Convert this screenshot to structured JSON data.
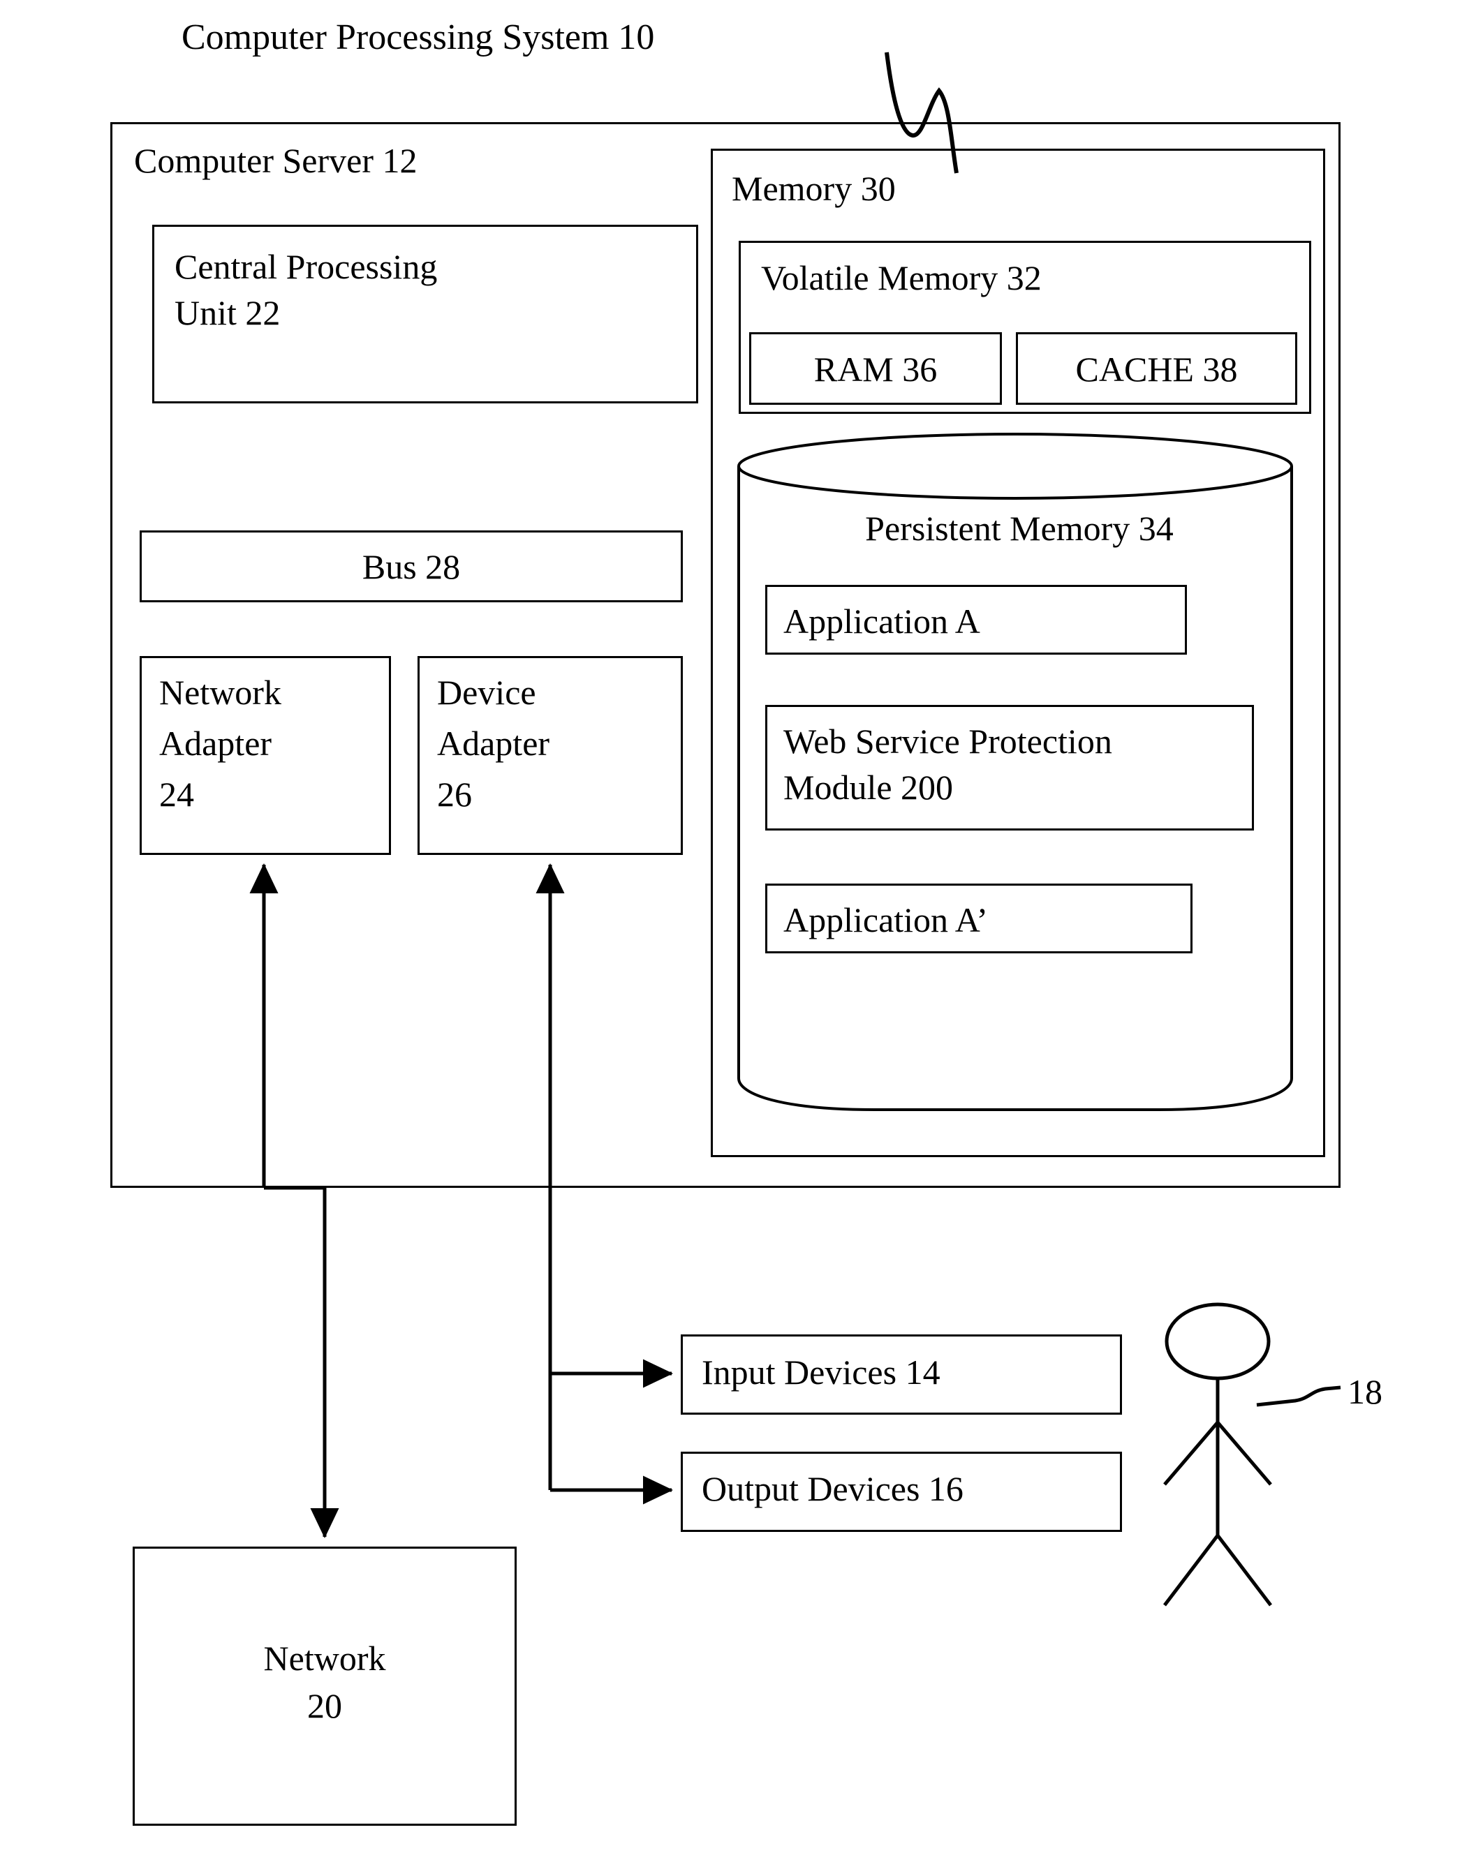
{
  "figure": {
    "title": "Computer Processing System 10",
    "title_ref": "10"
  },
  "server": {
    "label": "Computer Server 12",
    "cpu": {
      "line1": "Central Processing",
      "line2": "Unit 22"
    },
    "bus": {
      "label": "Bus 28"
    },
    "network_adapter": {
      "line1": "Network",
      "line2": "Adapter",
      "line3": "24"
    },
    "device_adapter": {
      "line1": "Device",
      "line2": "Adapter",
      "line3": "26"
    }
  },
  "memory": {
    "label": "Memory 30",
    "volatile": {
      "label": "Volatile Memory 32",
      "ram": "RAM 36",
      "cache": "CACHE 38"
    },
    "persistent": {
      "label": "Persistent Memory 34",
      "items": [
        {
          "label": "Application A"
        },
        {
          "line1": "Web Service Protection",
          "line2": "Module 200"
        },
        {
          "label": "Application A’"
        }
      ]
    }
  },
  "peripherals": {
    "input_devices": "Input Devices 14",
    "output_devices": "Output Devices 16",
    "network": {
      "line1": "Network",
      "line2": "20"
    },
    "user_ref": "18"
  },
  "colors": {
    "stroke": "#000000",
    "background": "#ffffff"
  },
  "icons": {
    "user": "stick-figure-icon",
    "cylinder": "database-cylinder-icon",
    "leader": "leader-line-icon"
  }
}
